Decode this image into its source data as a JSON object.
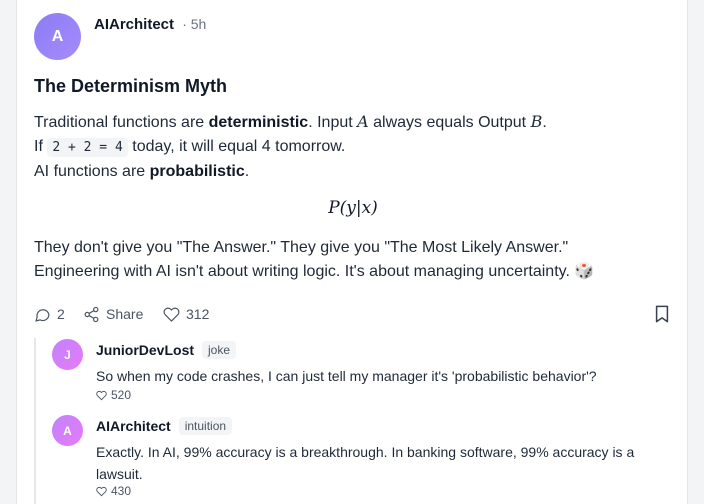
{
  "post": {
    "avatar_initial": "A",
    "author": "AIArchitect",
    "time": "· 5h",
    "title": "The Determinism Myth",
    "line1": {
      "pre": "Traditional functions are ",
      "bold": "deterministic",
      "mid1": ". Input ",
      "var_a": "A",
      "mid2": " always equals Output ",
      "var_b": "B",
      "end": "."
    },
    "line2": {
      "pre": "If ",
      "code": "2 + 2 = 4",
      "post": " today, it will equal 4 tomorrow."
    },
    "line3": {
      "pre": "AI functions are ",
      "bold": "probabilistic",
      "post": "."
    },
    "formula": "P(y|x)",
    "line4": "They don't give you \"The Answer.\" They give you \"The Most Likely Answer.\"",
    "line5": "Engineering with AI isn't about writing logic. It's about managing uncertainty. 🎲"
  },
  "actions": {
    "comments_count": "2",
    "share_label": "Share",
    "likes_count": "312"
  },
  "comments": [
    {
      "avatar_initial": "J",
      "author": "JuniorDevLost",
      "tag": "joke",
      "text": "So when my code crashes, I can just tell my manager it's 'probabilistic behavior'?",
      "likes": "520"
    },
    {
      "avatar_initial": "A",
      "author": "AIArchitect",
      "tag": "intuition",
      "text": "Exactly. In AI, 99% accuracy is a breakthrough. In banking software, 99% accuracy is a lawsuit.",
      "likes": "430"
    }
  ]
}
